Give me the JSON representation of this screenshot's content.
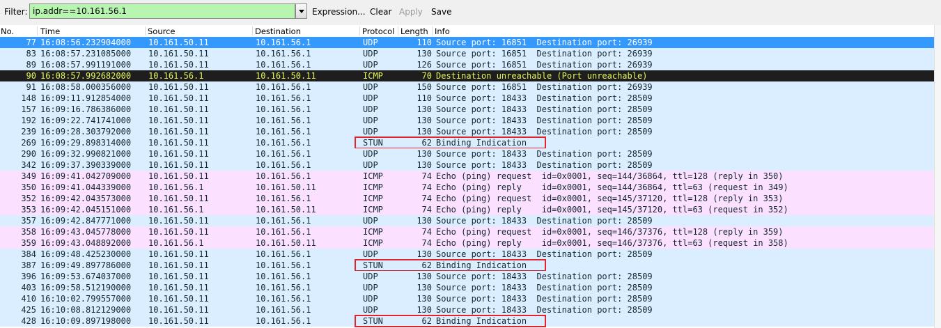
{
  "filter": {
    "label": "Filter:",
    "value": "ip.addr==10.161.56.1",
    "expression": "Expression...",
    "clear": "Clear",
    "apply": "Apply",
    "save": "Save"
  },
  "columns": [
    "No.",
    "Time",
    "Source",
    "Destination",
    "Protocol",
    "Length",
    "Info"
  ],
  "colors": {
    "udp_bg": "#daeeff",
    "icmp_bg": "#fce0ff",
    "stun_bg": "#daeeff",
    "selected_bg": "#3399ff",
    "selected_fg": "#ffffff",
    "error_bg": "#1e1e1e",
    "error_fg": "#e6f55a",
    "text": "#12272e",
    "highlight_box": "#e0242b"
  },
  "packets": [
    {
      "no": "77",
      "time": "16:08:56.232904000",
      "src": "10.161.50.11",
      "dst": "10.161.56.1",
      "proto": "UDP",
      "len": "110",
      "info": "Source port: 16851  Destination port: 26939",
      "style": "selected"
    },
    {
      "no": "83",
      "time": "16:08:57.231085000",
      "src": "10.161.50.11",
      "dst": "10.161.56.1",
      "proto": "UDP",
      "len": "130",
      "info": "Source port: 16851  Destination port: 26939",
      "style": "udp"
    },
    {
      "no": "89",
      "time": "16:08:57.991191000",
      "src": "10.161.50.11",
      "dst": "10.161.56.1",
      "proto": "UDP",
      "len": "126",
      "info": "Source port: 16851  Destination port: 26939",
      "style": "udp"
    },
    {
      "no": "90",
      "time": "16:08:57.992682000",
      "src": "10.161.56.1",
      "dst": "10.161.50.11",
      "proto": "ICMP",
      "len": "70",
      "info": "Destination unreachable (Port unreachable)",
      "style": "error"
    },
    {
      "no": "91",
      "time": "16:08:58.000356000",
      "src": "10.161.50.11",
      "dst": "10.161.56.1",
      "proto": "UDP",
      "len": "150",
      "info": "Source port: 16851  Destination port: 26939",
      "style": "udp"
    },
    {
      "no": "148",
      "time": "16:09:11.912854000",
      "src": "10.161.50.11",
      "dst": "10.161.56.1",
      "proto": "UDP",
      "len": "110",
      "info": "Source port: 18433  Destination port: 28509",
      "style": "udp"
    },
    {
      "no": "157",
      "time": "16:09:16.786386000",
      "src": "10.161.50.11",
      "dst": "10.161.56.1",
      "proto": "UDP",
      "len": "130",
      "info": "Source port: 18433  Destination port: 28509",
      "style": "udp"
    },
    {
      "no": "192",
      "time": "16:09:22.741741000",
      "src": "10.161.50.11",
      "dst": "10.161.56.1",
      "proto": "UDP",
      "len": "130",
      "info": "Source port: 18433  Destination port: 28509",
      "style": "udp"
    },
    {
      "no": "239",
      "time": "16:09:28.303792000",
      "src": "10.161.50.11",
      "dst": "10.161.56.1",
      "proto": "UDP",
      "len": "130",
      "info": "Source port: 18433  Destination port: 28509",
      "style": "udp"
    },
    {
      "no": "269",
      "time": "16:09:29.898314000",
      "src": "10.161.50.11",
      "dst": "10.161.56.1",
      "proto": "STUN",
      "len": "62",
      "info": "Binding Indication",
      "style": "stun",
      "highlight": true
    },
    {
      "no": "290",
      "time": "16:09:32.990821000",
      "src": "10.161.50.11",
      "dst": "10.161.56.1",
      "proto": "UDP",
      "len": "130",
      "info": "Source port: 18433  Destination port: 28509",
      "style": "udp"
    },
    {
      "no": "342",
      "time": "16:09:37.390339000",
      "src": "10.161.50.11",
      "dst": "10.161.56.1",
      "proto": "UDP",
      "len": "130",
      "info": "Source port: 18433  Destination port: 28509",
      "style": "udp"
    },
    {
      "no": "349",
      "time": "16:09:41.042709000",
      "src": "10.161.50.11",
      "dst": "10.161.56.1",
      "proto": "ICMP",
      "len": "74",
      "info": "Echo (ping) request  id=0x0001, seq=144/36864, ttl=128 (reply in 350)",
      "style": "icmp"
    },
    {
      "no": "350",
      "time": "16:09:41.044339000",
      "src": "10.161.56.1",
      "dst": "10.161.50.11",
      "proto": "ICMP",
      "len": "74",
      "info": "Echo (ping) reply    id=0x0001, seq=144/36864, ttl=63 (request in 349)",
      "style": "icmp"
    },
    {
      "no": "352",
      "time": "16:09:42.043573000",
      "src": "10.161.50.11",
      "dst": "10.161.56.1",
      "proto": "ICMP",
      "len": "74",
      "info": "Echo (ping) request  id=0x0001, seq=145/37120, ttl=128 (reply in 353)",
      "style": "icmp"
    },
    {
      "no": "353",
      "time": "16:09:42.045151000",
      "src": "10.161.56.1",
      "dst": "10.161.50.11",
      "proto": "ICMP",
      "len": "74",
      "info": "Echo (ping) reply    id=0x0001, seq=145/37120, ttl=63 (request in 352)",
      "style": "icmp"
    },
    {
      "no": "357",
      "time": "16:09:42.847771000",
      "src": "10.161.50.11",
      "dst": "10.161.56.1",
      "proto": "UDP",
      "len": "130",
      "info": "Source port: 18433  Destination port: 28509",
      "style": "udp"
    },
    {
      "no": "358",
      "time": "16:09:43.045778000",
      "src": "10.161.50.11",
      "dst": "10.161.56.1",
      "proto": "ICMP",
      "len": "74",
      "info": "Echo (ping) request  id=0x0001, seq=146/37376, ttl=128 (reply in 359)",
      "style": "icmp"
    },
    {
      "no": "359",
      "time": "16:09:43.048892000",
      "src": "10.161.56.1",
      "dst": "10.161.50.11",
      "proto": "ICMP",
      "len": "74",
      "info": "Echo (ping) reply    id=0x0001, seq=146/37376, ttl=63 (request in 358)",
      "style": "icmp"
    },
    {
      "no": "384",
      "time": "16:09:48.425230000",
      "src": "10.161.50.11",
      "dst": "10.161.56.1",
      "proto": "UDP",
      "len": "130",
      "info": "Source port: 18433  Destination port: 28509",
      "style": "udp"
    },
    {
      "no": "387",
      "time": "16:09:49.897786000",
      "src": "10.161.50.11",
      "dst": "10.161.56.1",
      "proto": "STUN",
      "len": "62",
      "info": "Binding Indication",
      "style": "stun",
      "highlight": true
    },
    {
      "no": "396",
      "time": "16:09:53.674037000",
      "src": "10.161.50.11",
      "dst": "10.161.56.1",
      "proto": "UDP",
      "len": "130",
      "info": "Source port: 18433  Destination port: 28509",
      "style": "udp"
    },
    {
      "no": "403",
      "time": "16:09:58.512190000",
      "src": "10.161.50.11",
      "dst": "10.161.56.1",
      "proto": "UDP",
      "len": "130",
      "info": "Source port: 18433  Destination port: 28509",
      "style": "udp"
    },
    {
      "no": "410",
      "time": "16:10:02.799557000",
      "src": "10.161.50.11",
      "dst": "10.161.56.1",
      "proto": "UDP",
      "len": "130",
      "info": "Source port: 18433  Destination port: 28509",
      "style": "udp"
    },
    {
      "no": "425",
      "time": "16:10:08.812129000",
      "src": "10.161.50.11",
      "dst": "10.161.56.1",
      "proto": "UDP",
      "len": "130",
      "info": "Source port: 18433  Destination port: 28509",
      "style": "udp"
    },
    {
      "no": "428",
      "time": "16:10:09.897198000",
      "src": "10.161.50.11",
      "dst": "10.161.56.1",
      "proto": "STUN",
      "len": "62",
      "info": "Binding Indication",
      "style": "stun",
      "highlight": true
    }
  ]
}
